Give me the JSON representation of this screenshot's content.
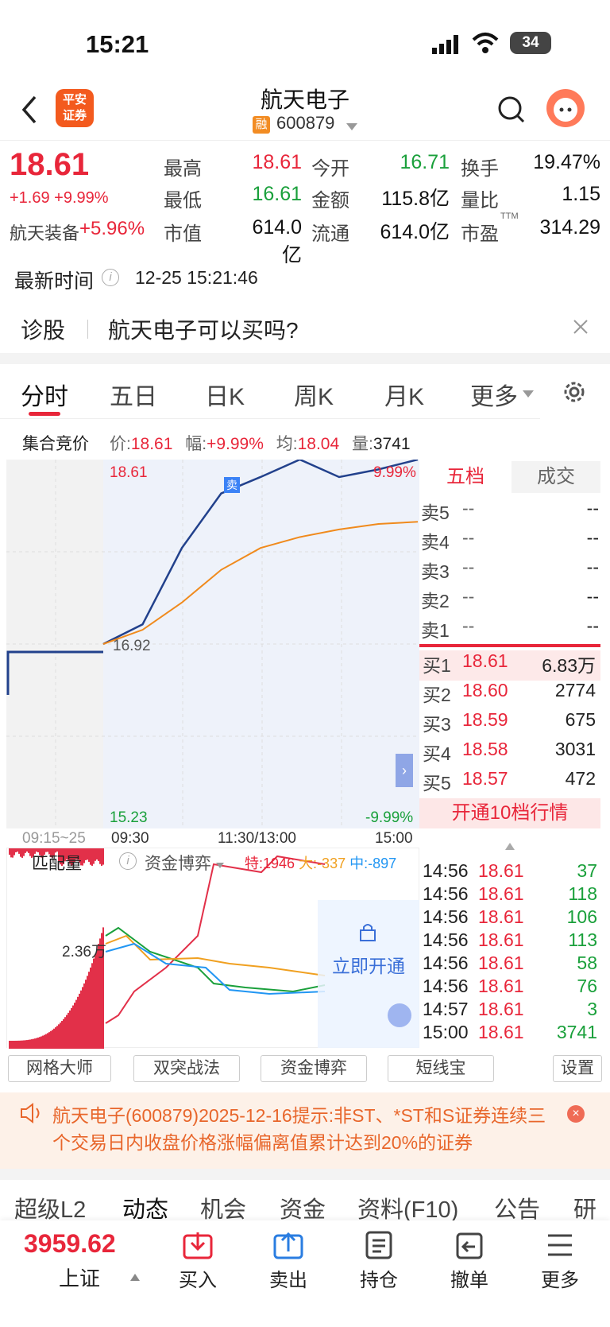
{
  "status": {
    "time": "15:21",
    "battery": "34"
  },
  "header": {
    "title": "航天电子",
    "code": "600879",
    "rong": "融",
    "logo_line1": "平安",
    "logo_line2": "证券"
  },
  "quote": {
    "price": "18.61",
    "change": "+1.69",
    "pct": "+9.99%",
    "sector_name": "航天装备",
    "sector_pct": "+5.96%",
    "stats": [
      {
        "label": "最高",
        "value": "18.61",
        "color": "red"
      },
      {
        "label": "今开",
        "value": "16.71",
        "color": "green"
      },
      {
        "label": "换手",
        "value": "19.47%",
        "color": "black"
      },
      {
        "label": "最低",
        "value": "16.61",
        "color": "green"
      },
      {
        "label": "金额",
        "value": "115.8亿",
        "color": "black"
      },
      {
        "label": "量比",
        "value": "1.15",
        "color": "black"
      },
      {
        "label": "市值",
        "value": "614.0亿",
        "color": "black"
      },
      {
        "label": "流通",
        "value": "614.0亿",
        "color": "black"
      },
      {
        "label": "市盈",
        "value": "314.29",
        "color": "black",
        "sup": "TTM"
      }
    ]
  },
  "latest": {
    "label": "最新时间",
    "value": "12-25 15:21:46"
  },
  "diagnose": {
    "label": "诊股",
    "question": "航天电子可以买吗?"
  },
  "chart_tabs": [
    "分时",
    "五日",
    "日K",
    "周K",
    "月K",
    "更多"
  ],
  "auction": {
    "label": "集合竞价",
    "price_label": "价:",
    "price": "18.61",
    "amp_label": "幅:",
    "amp": "+9.99%",
    "avg_label": "均:",
    "avg": "18.04",
    "vol_label": "量:",
    "vol": "3741"
  },
  "chart": {
    "top_price": "18.61",
    "top_pct": "9.99%",
    "mid_price": "16.92",
    "bottom_price": "15.23",
    "bottom_pct": "-9.99%",
    "sell_marker": "卖",
    "time_labels": [
      "09:15~25",
      "09:30",
      "11:30/13:00",
      "15:00"
    ]
  },
  "chart_data": {
    "type": "line",
    "title": "",
    "x": [
      "09:30",
      "10:00",
      "10:30",
      "11:00",
      "11:30/13:00",
      "13:30",
      "14:00",
      "14:30",
      "15:00"
    ],
    "series": [
      {
        "name": "",
        "values": [
          16.92,
          17.1,
          17.8,
          18.3,
          18.45,
          18.61,
          18.45,
          18.52,
          18.61
        ],
        "color": "#22418c"
      },
      {
        "name": "",
        "values": [
          16.92,
          17.05,
          17.3,
          17.6,
          17.8,
          17.9,
          17.97,
          18.02,
          18.04
        ],
        "color": "#f08a1c"
      }
    ],
    "ylim": [
      15.23,
      18.61
    ]
  },
  "orderbook": {
    "tab_active": "五档",
    "tab_other": "成交",
    "asks": [
      {
        "label": "卖5",
        "price": "--",
        "vol": "--"
      },
      {
        "label": "卖4",
        "price": "--",
        "vol": "--"
      },
      {
        "label": "卖3",
        "price": "--",
        "vol": "--"
      },
      {
        "label": "卖2",
        "price": "--",
        "vol": "--"
      },
      {
        "label": "卖1",
        "price": "--",
        "vol": "--"
      }
    ],
    "bids": [
      {
        "label": "买1",
        "price": "18.61",
        "vol": "6.83万"
      },
      {
        "label": "买2",
        "price": "18.60",
        "vol": "2774"
      },
      {
        "label": "买3",
        "price": "18.59",
        "vol": "675"
      },
      {
        "label": "买4",
        "price": "18.58",
        "vol": "3031"
      },
      {
        "label": "买5",
        "price": "18.57",
        "vol": "472"
      }
    ],
    "upgrade": "开通10档行情"
  },
  "trades": [
    {
      "t": "14:56",
      "p": "18.61",
      "v": "37"
    },
    {
      "t": "14:56",
      "p": "18.61",
      "v": "118"
    },
    {
      "t": "14:56",
      "p": "18.61",
      "v": "106"
    },
    {
      "t": "14:56",
      "p": "18.61",
      "v": "113"
    },
    {
      "t": "14:56",
      "p": "18.61",
      "v": "58"
    },
    {
      "t": "14:56",
      "p": "18.61",
      "v": "76"
    },
    {
      "t": "14:57",
      "p": "18.61",
      "v": "3"
    },
    {
      "t": "15:00",
      "p": "18.61",
      "v": "3741"
    }
  ],
  "sub": {
    "match_label": "匹配量",
    "match_value": "2.36万",
    "indicator": "资金博弈",
    "te": "特:1946",
    "da": "大:-337",
    "zhong": "中:-897",
    "unlock": "立即开通"
  },
  "tools": [
    "网格大师",
    "双突战法",
    "资金博弈",
    "短线宝",
    "设置"
  ],
  "notice": "航天电子(600879)2025-12-16提示:非ST、*ST和S证券连续三个交易日内收盘价格涨幅偏离值累计达到20%的证券",
  "info_tabs": [
    "超级L2",
    "动态",
    "机会",
    "资金",
    "资料(F10)",
    "公告",
    "研报"
  ],
  "bottom": {
    "index_value": "3959.62",
    "index_name": "上证",
    "items": [
      "买入",
      "卖出",
      "持仓",
      "撤单",
      "更多"
    ]
  }
}
